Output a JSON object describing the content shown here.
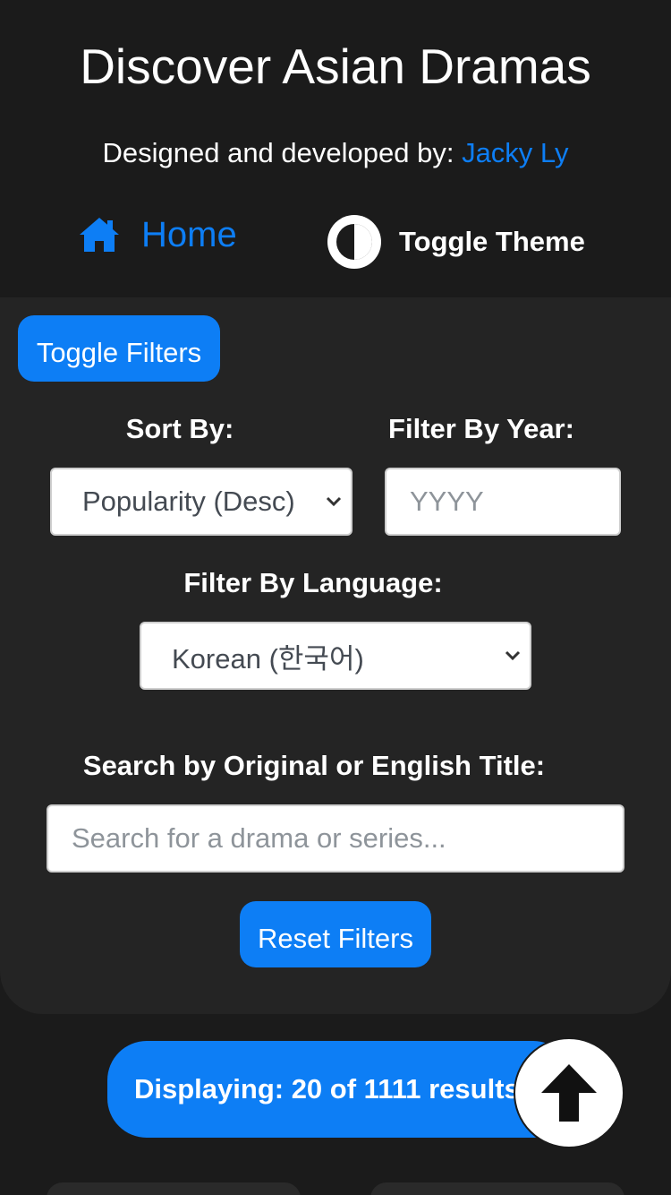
{
  "header": {
    "title": "Discover Asian Dramas",
    "credit_prefix": "Designed and developed by: ",
    "credit_author": "Jacky Ly"
  },
  "nav": {
    "home_label": "Home",
    "home_icon": "home-icon",
    "toggle_theme_label": "Toggle Theme",
    "toggle_theme_icon": "half-circle-contrast-icon"
  },
  "filters": {
    "toggle_label": "Toggle Filters",
    "sort_label": "Sort By:",
    "sort_value": "Popularity (Desc)",
    "year_label": "Filter By Year:",
    "year_placeholder": "YYYY",
    "language_label": "Filter By Language:",
    "language_value": "Korean (한국어)",
    "search_label": "Search by Original or English Title:",
    "search_placeholder": "Search for a drama or series...",
    "reset_label": "Reset Filters"
  },
  "results": {
    "text": "Displaying: 20 of 1111 results",
    "scroll_top_icon": "arrow-up-icon"
  },
  "colors": {
    "accent": "#0d7ef5",
    "background": "#1b1b1b",
    "panel": "#242424"
  }
}
